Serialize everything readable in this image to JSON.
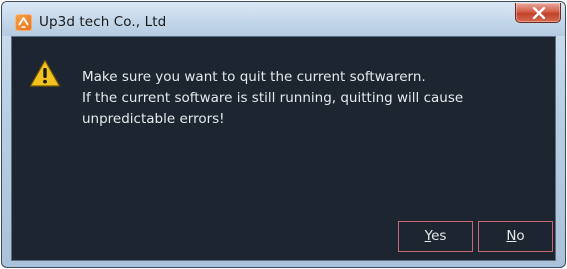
{
  "window": {
    "title": "Up3d tech Co., Ltd",
    "close_glyph": "✕"
  },
  "icons": {
    "app": "up3d-logo-icon",
    "warning": "warning-icon",
    "close": "close-icon"
  },
  "dialog": {
    "message_lines": [
      "Make sure you want to quit the current softwarern.",
      "If the current software is still running, quitting will cause",
      "unpredictable errors!"
    ],
    "buttons": {
      "yes": {
        "mnemonic": "Y",
        "rest": "es"
      },
      "no": {
        "mnemonic": "N",
        "rest": "o"
      }
    }
  },
  "colors": {
    "content_bg": "#1c2530",
    "text": "#e6e9ec",
    "button_border": "#c66a74",
    "warning_yellow": "#f3c31d"
  }
}
